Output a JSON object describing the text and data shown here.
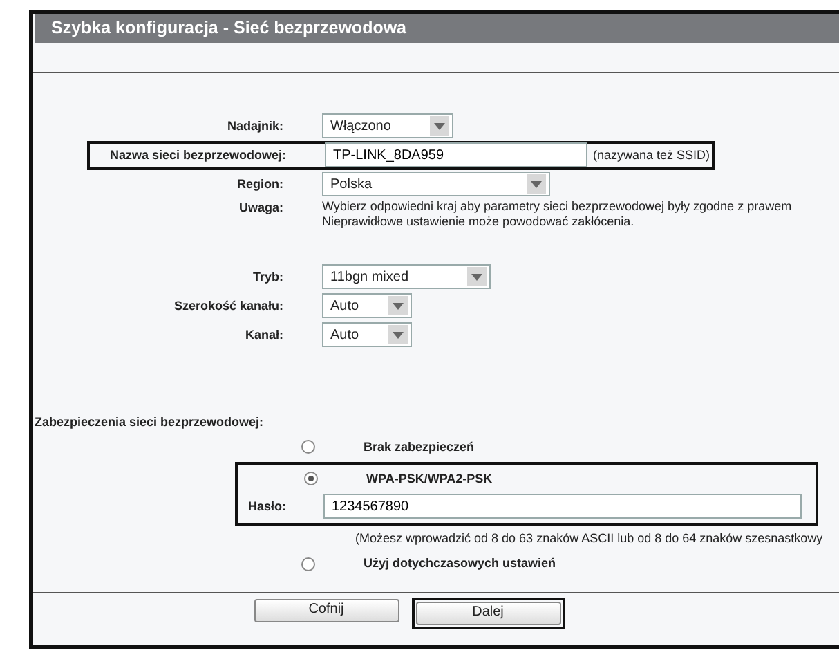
{
  "window": {
    "title": "Szybka konfiguracja - Sieć bezprzewodowa"
  },
  "settings": [
    {
      "kind": "select",
      "label": "Nadajnik:",
      "value": "Włączono"
    },
    {
      "kind": "text",
      "label": "Nazwa sieci bezprzewodowej:",
      "value": "TP-LINK_8DA959",
      "note": "(nazywana też SSID)",
      "highlighted": true
    },
    {
      "kind": "select",
      "label": "Region:",
      "value": "Polska"
    },
    {
      "kind": "info",
      "label": "Uwaga:",
      "lines": [
        "Wybierz odpowiedni kraj aby parametry sieci bezprzewodowej były zgodne z prawem",
        "Nieprawidłowe ustawienie może powodować zakłócenia."
      ]
    },
    {
      "kind": "gap"
    },
    {
      "kind": "select",
      "label": "Tryb:",
      "value": "11bgn mixed"
    },
    {
      "kind": "select",
      "label": "Szerokość kanału:",
      "value": "Auto"
    },
    {
      "kind": "select",
      "label": "Kanał:",
      "value": "Auto"
    }
  ],
  "security": {
    "heading": "Zabezpieczenia sieci bezprzewodowej:",
    "options": [
      {
        "label": "Brak zabezpieczeń",
        "selected": false,
        "highlighted": false
      },
      {
        "label": "WPA-PSK/WPA2-PSK",
        "selected": true,
        "highlighted": true,
        "password": {
          "label": "Hasło:",
          "value": "1234567890"
        },
        "hint": "(Możesz wprowadzić od 8 do 63 znaków ASCII lub od 8 do 64 znaków szesnastkowy"
      },
      {
        "label": "Użyj dotychczasowych ustawień",
        "selected": false,
        "highlighted": false
      }
    ]
  },
  "buttons": [
    {
      "label": "Cofnij",
      "highlighted": false
    },
    {
      "label": "Dalej",
      "highlighted": true
    }
  ]
}
